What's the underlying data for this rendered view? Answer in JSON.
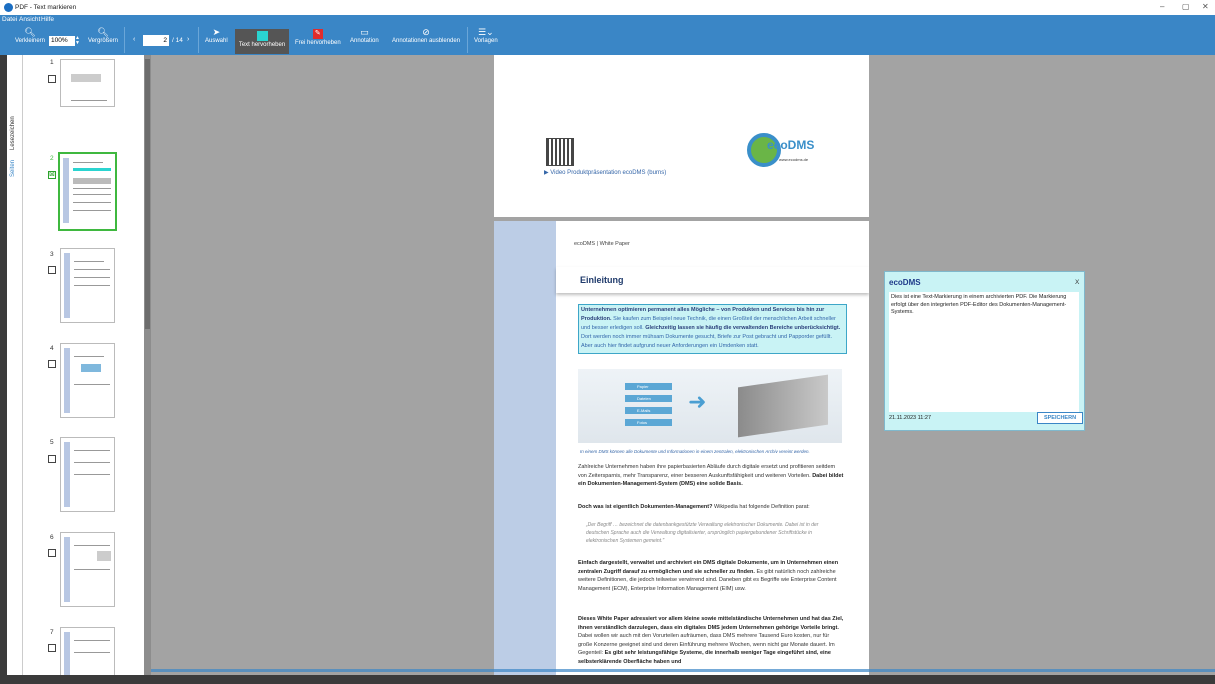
{
  "window": {
    "title": "PDF - Text markieren",
    "minimize": "–",
    "maximize": "▢",
    "close": "✕"
  },
  "menu": [
    "Datei",
    "Ansicht",
    "Hilfe"
  ],
  "toolbar": {
    "zoom_out": "Verkleinern",
    "zoom_value": "100%",
    "zoom_in": "Vergrößern",
    "page_current": "2",
    "page_total": "/ 14",
    "select": "Auswahl",
    "text_highlight": "Text hervorheben",
    "free_highlight": "Frei hervorheben",
    "annotation": "Annotation",
    "hide_annotations": "Annotationen ausblenden",
    "templates": "Vorlagen"
  },
  "sidebar_tabs": [
    "Lesezeichen",
    "Seiten"
  ],
  "thumbnails": [
    {
      "num": "1",
      "checked": false
    },
    {
      "num": "2",
      "checked": true
    },
    {
      "num": "3",
      "checked": false
    },
    {
      "num": "4",
      "checked": false
    },
    {
      "num": "5",
      "checked": false
    },
    {
      "num": "6",
      "checked": false
    },
    {
      "num": "7",
      "checked": false
    }
  ],
  "page1": {
    "video_link": "▶  Video Produktpräsentation ecoDMS (burns)",
    "logo_text": "ecoDMS",
    "logo_url": "www.ecodms.de"
  },
  "page2": {
    "header": "ecoDMS  |  White Paper",
    "title": "Einleitung",
    "highlight_bold1": "Unternehmen optimieren permanent alles Mögliche – von Produkten und Services bis hin zur Produktion.",
    "highlight_text1": " Sie kaufen zum Beispiel neue Technik, die einen Großteil der menschlichen Arbeit schneller und besser erledigen soll.",
    "highlight_bold2": " Gleichzeitig lassen sie häufig die verwaltenden Bereiche unberücksichtigt.",
    "highlight_text2": " Dort werden noch immer mühsam Dokumente gesucht, Briefe zur Post gebracht und Papporder gefüllt. Aber auch hier findet aufgrund neuer Anforderungen ein Umdenken statt.",
    "graphic_labels": [
      "Papier",
      "Dateien",
      "E-Mails",
      "Fotos"
    ],
    "caption": "In einem DMS können alle Dokumente und Informationen in einem zentralen, elektronischen Archiv vereint werden.",
    "para1": "Zahlreiche Unternehmen haben ihre papierbasierten Abläufe durch digitale ersetzt und profitieren seitdem von Zeitersparnis, mehr Transparenz, einer besseren Auskunftsfähigkeit und weiteren Vorteilen. ",
    "para1_bold": "Dabei bildet ein Dokumenten-Management-System (DMS) eine solide Basis.",
    "para2_bold": "Doch was ist eigentlich Dokumenten-Management?",
    "para2": " Wikipedia hat folgende Definition parat:",
    "quote": "„Der Begriff … bezeichnet die datenbankgestützte Verwaltung elektronischer Dokumente. Dabei ist in der deutschen Sprache auch die Verwaltung digitalisierter, ursprünglich papiergebundener Schriftstücke in elektronischen Systemen gemeint.\"",
    "para3_bold": "Einfach dargestellt, verwaltet und archiviert ein DMS digitale Dokumente, um in Unternehmen einen zentralen Zugriff darauf zu ermöglichen und sie schneller zu finden.",
    "para3": " Es gibt natürlich noch zahlreiche weitere Definitionen, die jedoch teilweise verwirrend sind. Daneben gibt es Begriffe wie Enterprise Content Management (ECM), Enterprise Information Management (EIM) usw.",
    "para4_bold": "Dieses White Paper adressiert vor allem kleine sowie mittelständische Unternehmen und hat das Ziel, ihnen verständlich darzulegen, dass ein digitales DMS jedem Unternehmen gehörige Vorteile bringt.",
    "para4": " Dabei wollen wir auch mit den Vorurteilen aufräumen, dass DMS mehrere Tausend Euro kosten, nur für große Konzerne geeignet sind und deren Einführung mehrere Wochen, wenn nicht gar Monate dauert. Im Gegenteil: ",
    "para4_bold2": "Es gibt sehr leistungsfähige Systeme, die innerhalb weniger Tage eingeführt sind, eine selbsterklärende Oberfläche haben und"
  },
  "popup": {
    "title": "ecoDMS",
    "close": "X",
    "text": "Dies ist eine Text-Markierung in einem archivierten PDF. Die Markierung erfolgt über den integrierten PDF-Editor des Dokumenten-Management-Systems.",
    "date": "21.11.2023 11:27",
    "save": "SPEICHERN"
  },
  "colors": {
    "ribbon": "#3a86c6",
    "highlight": "#c9f3f5",
    "selected_thumb": "#3fb83f",
    "background": "#a3a3a3"
  }
}
